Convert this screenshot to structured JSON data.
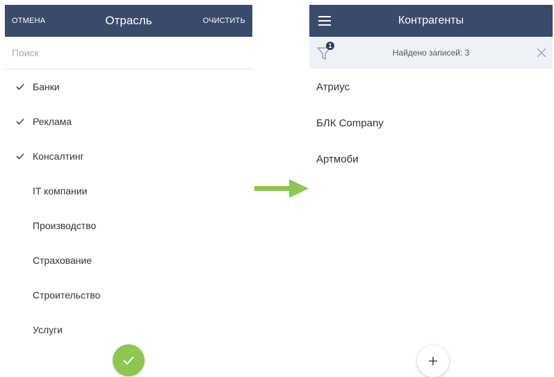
{
  "industry_picker": {
    "cancel_label": "ОТМЕНА",
    "title": "Отрасль",
    "clear_label": "ОЧИСТИТЬ",
    "search_placeholder": "Поиск",
    "items": [
      {
        "label": "Банки",
        "checked": true
      },
      {
        "label": "Реклама",
        "checked": true
      },
      {
        "label": "Консалтинг",
        "checked": true
      },
      {
        "label": "IT компании",
        "checked": false
      },
      {
        "label": "Производство",
        "checked": false
      },
      {
        "label": "Страхование",
        "checked": false
      },
      {
        "label": "Строительство",
        "checked": false
      },
      {
        "label": "Услуги",
        "checked": false
      }
    ],
    "accent_color": "#8cc751"
  },
  "accounts": {
    "title": "Контрагенты",
    "filter_count": "1",
    "found_text": "Найдено записей: 3",
    "records": [
      "Атриус",
      "БЛК Company",
      "Артмоби"
    ]
  },
  "colors": {
    "header_bg": "#3a4a6a",
    "filter_bar_bg": "#eef1f6",
    "check_color": "#3a4a6a",
    "arrow_color": "#8cc751"
  }
}
